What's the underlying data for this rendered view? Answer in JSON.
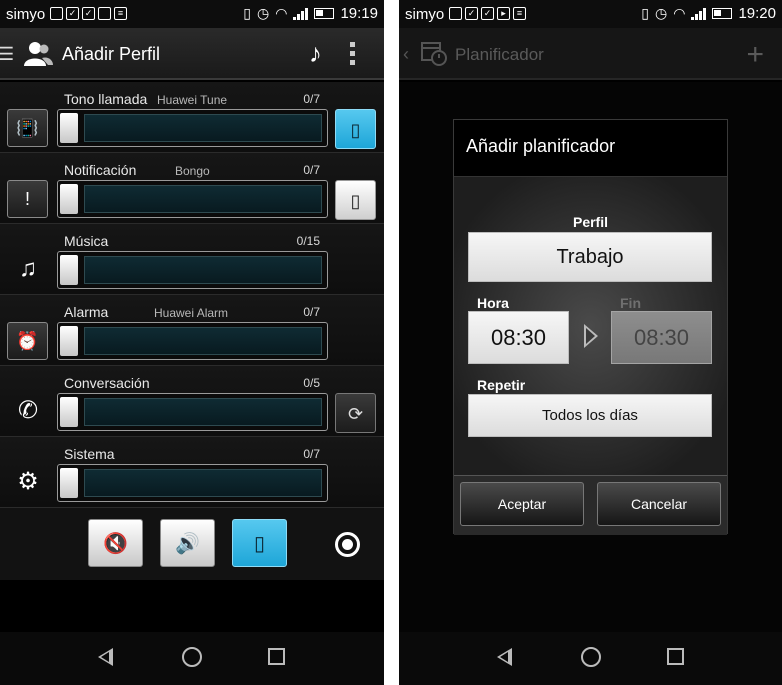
{
  "left": {
    "status": {
      "carrier": "simyo",
      "time": "19:19"
    },
    "header": {
      "title": "Añadir Perfil"
    },
    "rows": [
      {
        "label": "Tono llamada",
        "sub": "Huawei Tune",
        "count": "0/7",
        "level": 0
      },
      {
        "label": "Notificación",
        "sub": "Bongo",
        "count": "0/7",
        "level": 0
      },
      {
        "label": "Música",
        "sub": "",
        "count": "0/15",
        "level": 0
      },
      {
        "label": "Alarma",
        "sub": "Huawei Alarm",
        "count": "0/7",
        "level": 0
      },
      {
        "label": "Conversación",
        "sub": "",
        "count": "0/5",
        "level": 0
      },
      {
        "label": "Sistema",
        "sub": "",
        "count": "0/7",
        "level": 0
      }
    ]
  },
  "right": {
    "status": {
      "carrier": "simyo",
      "time": "19:20"
    },
    "header": {
      "title": "Planificador"
    },
    "dialog": {
      "title": "Añadir planificador",
      "perfil_label": "Perfil",
      "perfil_value": "Trabajo",
      "hora_label": "Hora",
      "hora_value": "08:30",
      "fin_label": "Fin",
      "fin_value": "08:30",
      "repetir_label": "Repetir",
      "repetir_value": "Todos los días",
      "accept": "Aceptar",
      "cancel": "Cancelar"
    }
  },
  "icons": {
    "ringtone": "phone-ring-icon",
    "notification": "notification-icon",
    "music": "music-note-icon",
    "alarm": "alarm-clock-icon",
    "call": "phone-handset-icon",
    "system": "gear-icon",
    "vibrate": "vibrate-icon",
    "sync": "sync-icon",
    "mute": "mute-icon",
    "volume": "volume-icon"
  },
  "colors": {
    "accent": "#2fb5e2",
    "background": "#000000"
  }
}
